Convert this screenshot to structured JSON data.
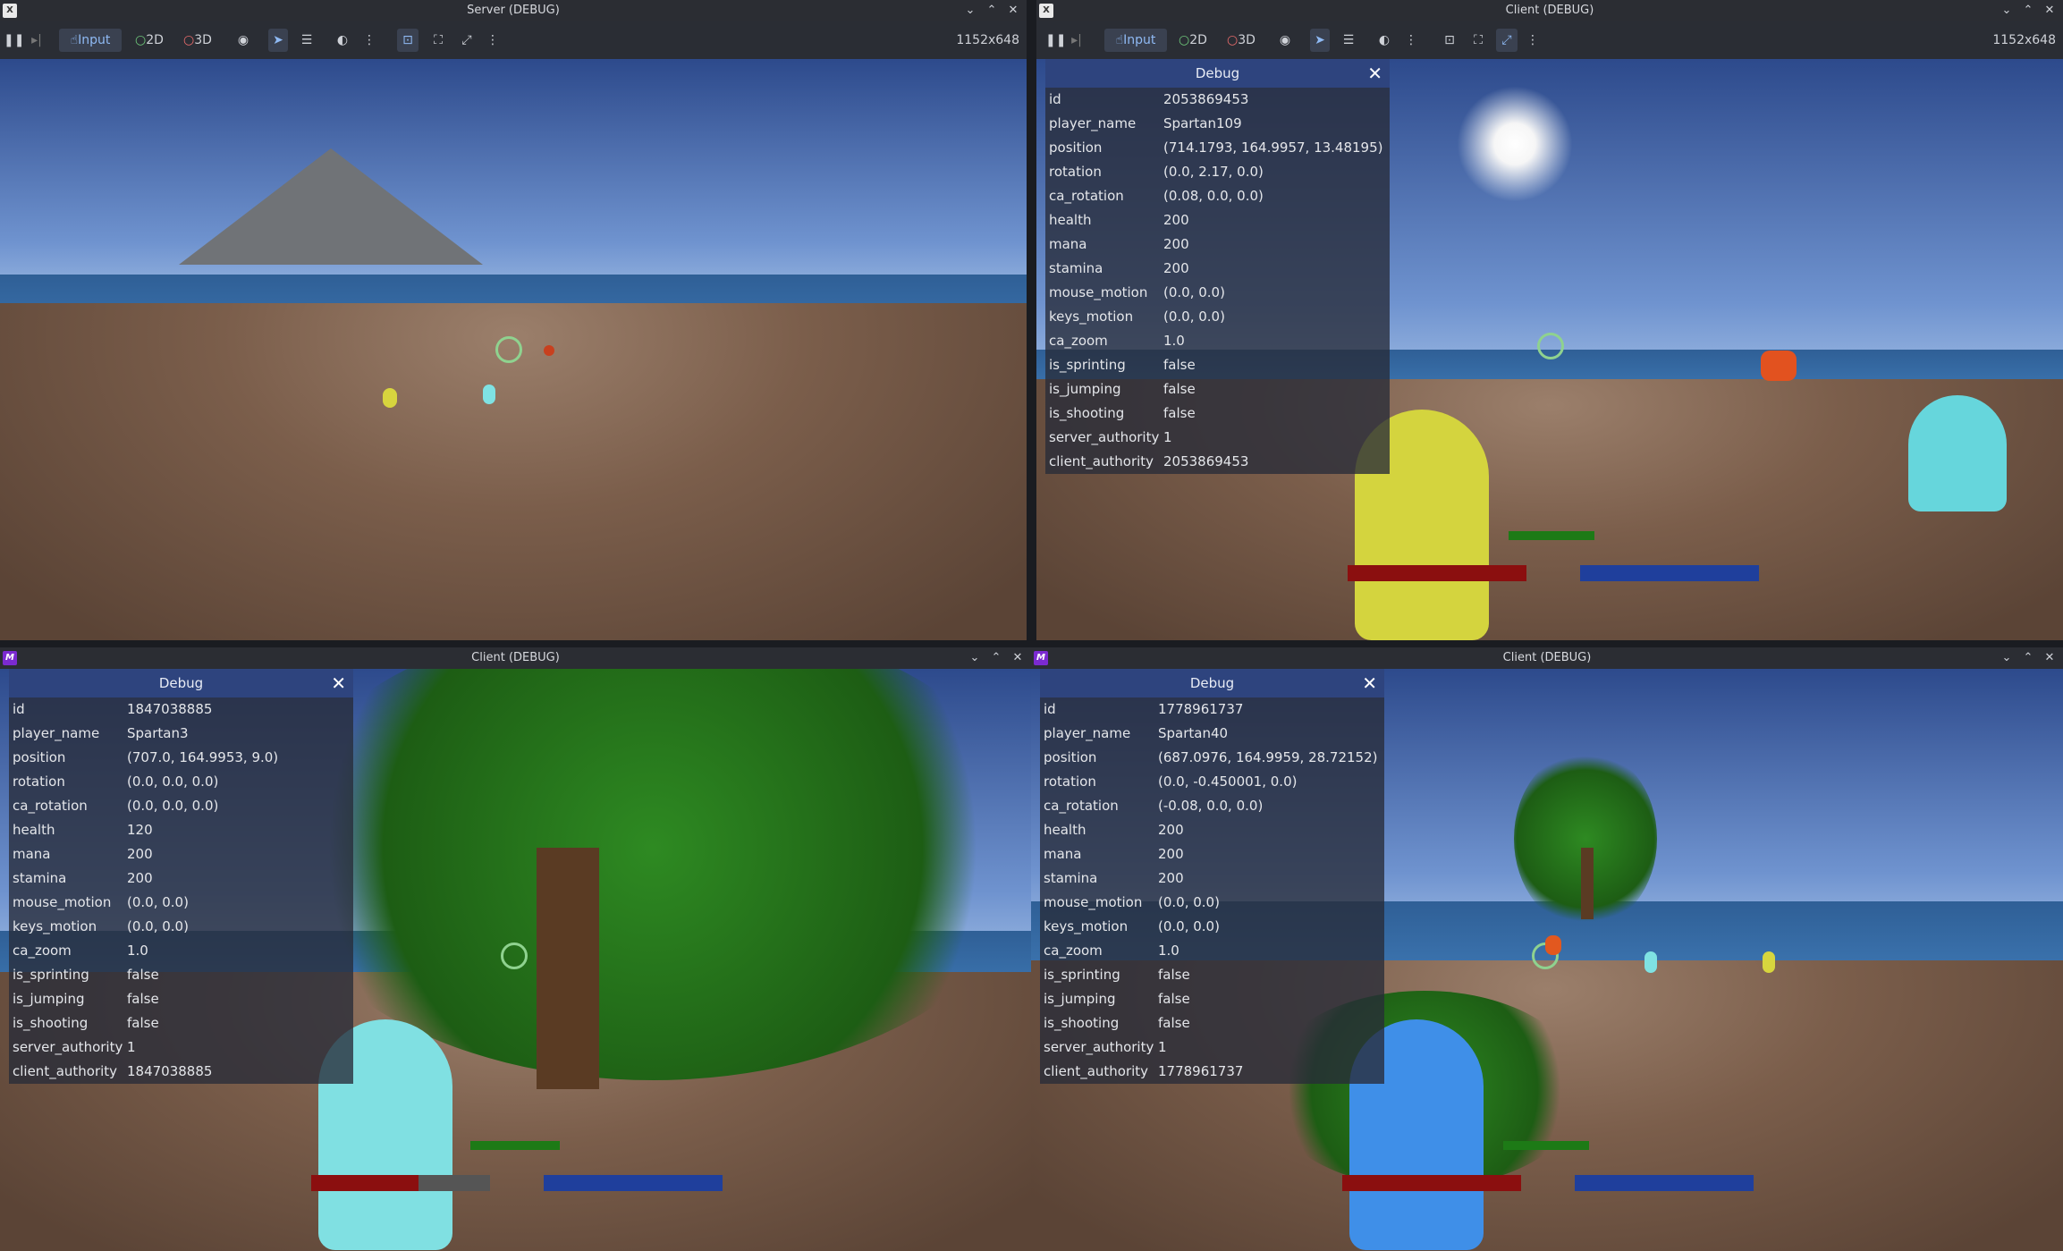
{
  "windows": {
    "server": {
      "title": "Server (DEBUG)",
      "res": "1152x648"
    },
    "client1": {
      "title": "Client (DEBUG)",
      "res": "1152x648"
    },
    "client2": {
      "title": "Client (DEBUG)"
    },
    "client3": {
      "title": "Client (DEBUG)"
    }
  },
  "toolbar": {
    "input": "Input",
    "d2": "2D",
    "d3": "3D"
  },
  "panels": {
    "p1": {
      "title": "Debug",
      "close": "✕",
      "rows": [
        [
          "id",
          "2053869453"
        ],
        [
          "player_name",
          "Spartan109"
        ],
        [
          "position",
          "(714.1793, 164.9957, 13.48195)"
        ],
        [
          "rotation",
          "(0.0, 2.17, 0.0)"
        ],
        [
          "ca_rotation",
          "(0.08, 0.0, 0.0)"
        ],
        [
          "health",
          "200"
        ],
        [
          "mana",
          "200"
        ],
        [
          "stamina",
          "200"
        ],
        [
          "mouse_motion",
          "(0.0, 0.0)"
        ],
        [
          "keys_motion",
          "(0.0, 0.0)"
        ],
        [
          "ca_zoom",
          "1.0"
        ],
        [
          "is_sprinting",
          "false"
        ],
        [
          "is_jumping",
          "false"
        ],
        [
          "is_shooting",
          "false"
        ],
        [
          "server_authority",
          "1"
        ],
        [
          "client_authority",
          "2053869453"
        ]
      ]
    },
    "p2": {
      "title": "Debug",
      "close": "✕",
      "rows": [
        [
          "id",
          "1847038885"
        ],
        [
          "player_name",
          "Spartan3"
        ],
        [
          "position",
          "(707.0, 164.9953, 9.0)"
        ],
        [
          "rotation",
          "(0.0, 0.0, 0.0)"
        ],
        [
          "ca_rotation",
          "(0.0, 0.0, 0.0)"
        ],
        [
          "health",
          "120"
        ],
        [
          "mana",
          "200"
        ],
        [
          "stamina",
          "200"
        ],
        [
          "mouse_motion",
          "(0.0, 0.0)"
        ],
        [
          "keys_motion",
          "(0.0, 0.0)"
        ],
        [
          "ca_zoom",
          "1.0"
        ],
        [
          "is_sprinting",
          "false"
        ],
        [
          "is_jumping",
          "false"
        ],
        [
          "is_shooting",
          "false"
        ],
        [
          "server_authority",
          "1"
        ],
        [
          "client_authority",
          "1847038885"
        ]
      ]
    },
    "p3": {
      "title": "Debug",
      "close": "✕",
      "rows": [
        [
          "id",
          "1778961737"
        ],
        [
          "player_name",
          "Spartan40"
        ],
        [
          "position",
          "(687.0976, 164.9959, 28.72152)"
        ],
        [
          "rotation",
          "(0.0, -0.450001, 0.0)"
        ],
        [
          "ca_rotation",
          "(-0.08, 0.0, 0.0)"
        ],
        [
          "health",
          "200"
        ],
        [
          "mana",
          "200"
        ],
        [
          "stamina",
          "200"
        ],
        [
          "mouse_motion",
          "(0.0, 0.0)"
        ],
        [
          "keys_motion",
          "(0.0, 0.0)"
        ],
        [
          "ca_zoom",
          "1.0"
        ],
        [
          "is_sprinting",
          "false"
        ],
        [
          "is_jumping",
          "false"
        ],
        [
          "is_shooting",
          "false"
        ],
        [
          "server_authority",
          "1"
        ],
        [
          "client_authority",
          "1778961737"
        ]
      ]
    }
  },
  "health_fraction": {
    "p1": 1.0,
    "p2": 0.6,
    "p3": 1.0
  },
  "colors": {
    "health": "#8b0f0f",
    "mana": "#1f3f9c",
    "stamina": "#1d7a16",
    "accent": "#8fbaf4"
  }
}
